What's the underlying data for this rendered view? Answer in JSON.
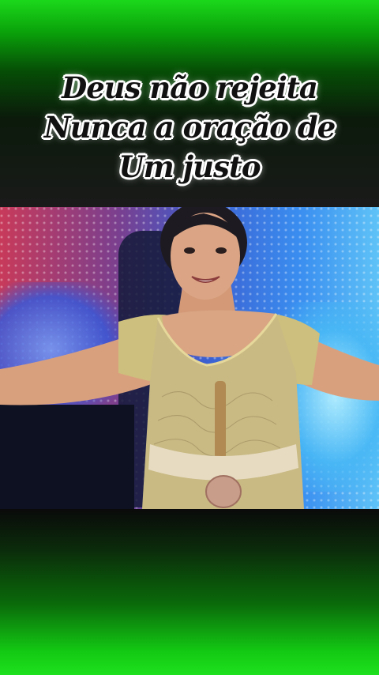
{
  "caption": {
    "line1": "Deus não rejeita",
    "line2": "Nunca a oração de",
    "line3": "Um justo"
  },
  "colors": {
    "top_green": "#1bd81b",
    "bottom_green": "#1ee01e",
    "caption_text": "#111111",
    "caption_outline": "#ffffff"
  }
}
